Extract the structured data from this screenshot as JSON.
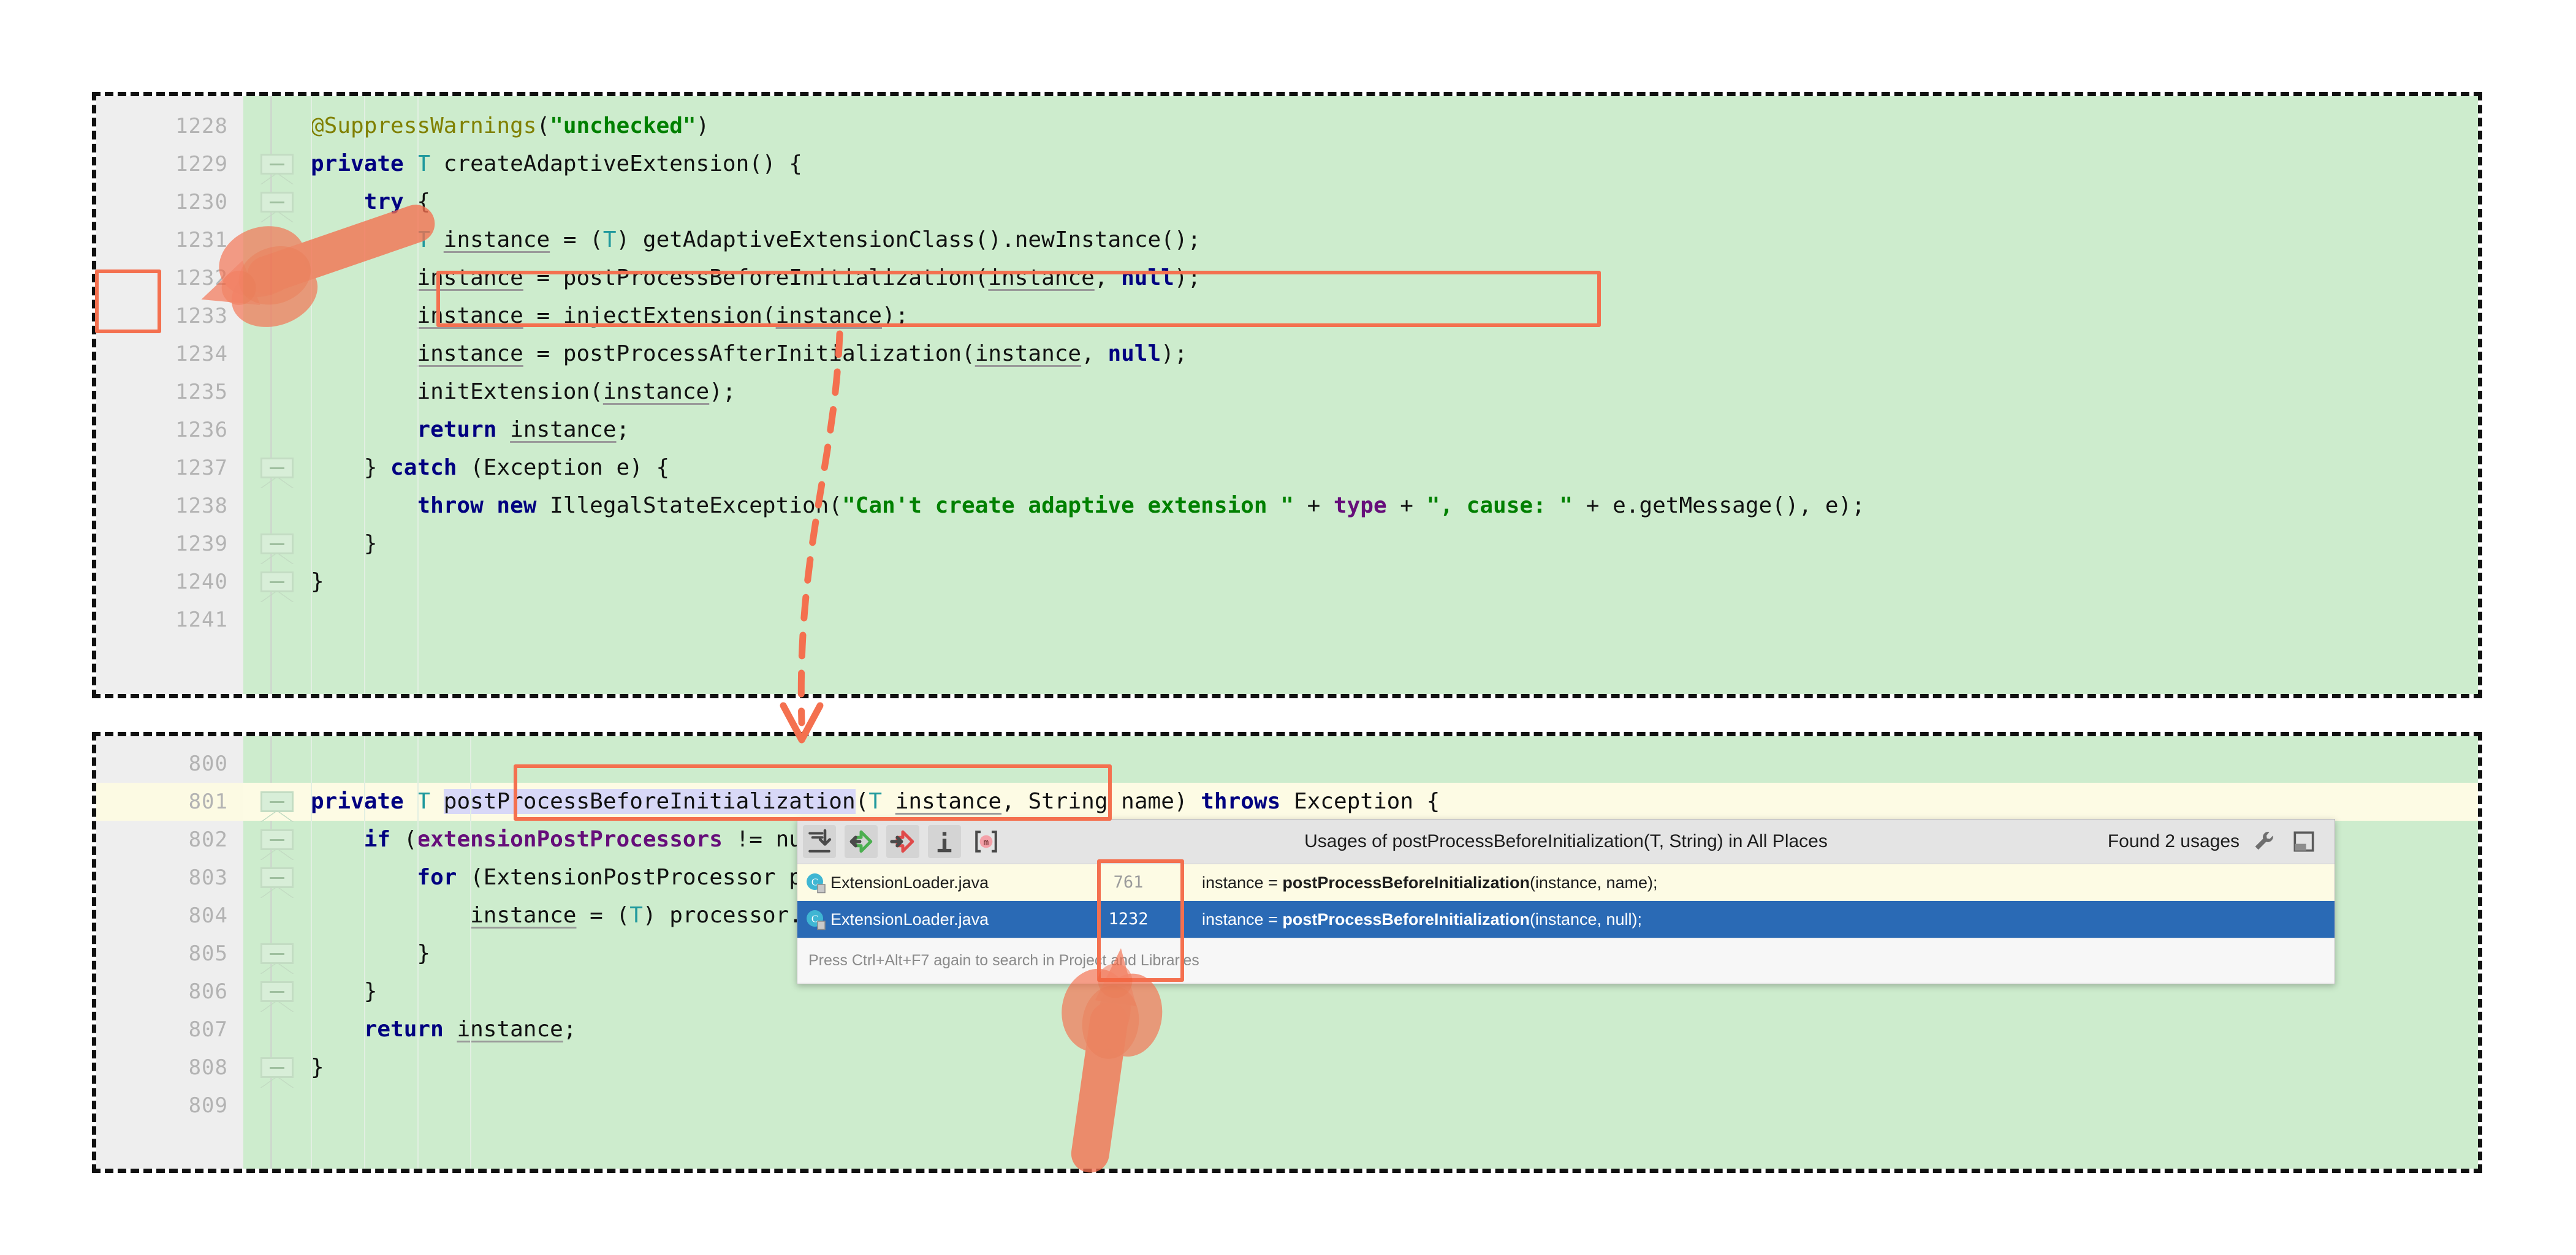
{
  "editor_top": {
    "name": "adaptive-extension-editor",
    "lines": [
      {
        "num": "1228",
        "indent": 2,
        "fold": false,
        "caret": false,
        "tokens": [
          {
            "t": "@SuppressWarnings",
            "c": "ann"
          },
          {
            "t": "(",
            "c": ""
          },
          {
            "t": "\"unchecked\"",
            "c": "str"
          },
          {
            "t": ")",
            "c": ""
          }
        ]
      },
      {
        "num": "1229",
        "indent": 2,
        "fold": true,
        "caret": false,
        "tokens": [
          {
            "t": "private ",
            "c": "kw"
          },
          {
            "t": "T",
            "c": "typ"
          },
          {
            "t": " createAdaptiveExtension() {",
            "c": ""
          }
        ]
      },
      {
        "num": "1230",
        "indent": 3,
        "fold": true,
        "caret": false,
        "tokens": [
          {
            "t": "    ",
            "c": ""
          },
          {
            "t": "try",
            "c": "kw"
          },
          {
            "t": " {",
            "c": ""
          }
        ]
      },
      {
        "num": "1231",
        "indent": 4,
        "fold": false,
        "caret": false,
        "tokens": [
          {
            "t": "        ",
            "c": ""
          },
          {
            "t": "T",
            "c": "typ"
          },
          {
            "t": " ",
            "c": ""
          },
          {
            "t": "instance",
            "c": "var"
          },
          {
            "t": " = (",
            "c": ""
          },
          {
            "t": "T",
            "c": "typ"
          },
          {
            "t": ") getAdaptiveExtensionClass().newInstance();",
            "c": ""
          }
        ]
      },
      {
        "num": "1232",
        "indent": 4,
        "fold": false,
        "caret": false,
        "tokens": [
          {
            "t": "        ",
            "c": ""
          },
          {
            "t": "instance",
            "c": "var"
          },
          {
            "t": " = postProcessBeforeInitialization(",
            "c": ""
          },
          {
            "t": "instance",
            "c": "var"
          },
          {
            "t": ", ",
            "c": ""
          },
          {
            "t": "null",
            "c": "kw"
          },
          {
            "t": ");",
            "c": ""
          }
        ]
      },
      {
        "num": "1233",
        "indent": 4,
        "fold": false,
        "caret": false,
        "tokens": [
          {
            "t": "        ",
            "c": ""
          },
          {
            "t": "instance",
            "c": "var"
          },
          {
            "t": " = injectExtension(",
            "c": ""
          },
          {
            "t": "instance",
            "c": "var"
          },
          {
            "t": ");",
            "c": ""
          }
        ]
      },
      {
        "num": "1234",
        "indent": 4,
        "fold": false,
        "caret": false,
        "tokens": [
          {
            "t": "        ",
            "c": ""
          },
          {
            "t": "instance",
            "c": "var"
          },
          {
            "t": " = postProcessAfterInitialization(",
            "c": ""
          },
          {
            "t": "instance",
            "c": "var"
          },
          {
            "t": ", ",
            "c": ""
          },
          {
            "t": "null",
            "c": "kw"
          },
          {
            "t": ");",
            "c": ""
          }
        ]
      },
      {
        "num": "1235",
        "indent": 4,
        "fold": false,
        "caret": false,
        "tokens": [
          {
            "t": "        initExtension(",
            "c": ""
          },
          {
            "t": "instance",
            "c": "var"
          },
          {
            "t": ");",
            "c": ""
          }
        ]
      },
      {
        "num": "1236",
        "indent": 4,
        "fold": false,
        "caret": false,
        "tokens": [
          {
            "t": "        ",
            "c": ""
          },
          {
            "t": "return",
            "c": "kw"
          },
          {
            "t": " ",
            "c": ""
          },
          {
            "t": "instance",
            "c": "var"
          },
          {
            "t": ";",
            "c": ""
          }
        ]
      },
      {
        "num": "1237",
        "indent": 3,
        "fold": true,
        "caret": false,
        "tokens": [
          {
            "t": "    } ",
            "c": ""
          },
          {
            "t": "catch",
            "c": "kw"
          },
          {
            "t": " (Exception e) {",
            "c": ""
          }
        ]
      },
      {
        "num": "1238",
        "indent": 4,
        "fold": false,
        "caret": false,
        "tokens": [
          {
            "t": "        ",
            "c": ""
          },
          {
            "t": "throw new",
            "c": "kw"
          },
          {
            "t": " IllegalStateException(",
            "c": ""
          },
          {
            "t": "\"Can't create adaptive extension \"",
            "c": "str"
          },
          {
            "t": " + ",
            "c": ""
          },
          {
            "t": "type",
            "c": "fld"
          },
          {
            "t": " + ",
            "c": ""
          },
          {
            "t": "\", cause: \"",
            "c": "str"
          },
          {
            "t": " + e.getMessage(), e);",
            "c": ""
          }
        ]
      },
      {
        "num": "1239",
        "indent": 3,
        "fold": true,
        "caret": false,
        "tokens": [
          {
            "t": "    }",
            "c": ""
          }
        ]
      },
      {
        "num": "1240",
        "indent": 2,
        "fold": true,
        "caret": false,
        "tokens": [
          {
            "t": "}",
            "c": ""
          }
        ]
      },
      {
        "num": "1241",
        "indent": 0,
        "fold": false,
        "caret": false,
        "tokens": []
      }
    ]
  },
  "editor_bottom": {
    "name": "post-process-editor",
    "lines": [
      {
        "num": "800",
        "indent": 0,
        "fold": false,
        "caret": false,
        "tokens": []
      },
      {
        "num": "801",
        "indent": 2,
        "fold": true,
        "caret": true,
        "tokens": [
          {
            "t": "private ",
            "c": "kw"
          },
          {
            "t": "T",
            "c": "typ"
          },
          {
            "t": " ",
            "c": ""
          },
          {
            "t": "postProcessBeforeInitialization",
            "c": "srch"
          },
          {
            "t": "(",
            "c": ""
          },
          {
            "t": "T",
            "c": "typ"
          },
          {
            "t": " ",
            "c": ""
          },
          {
            "t": "instance",
            "c": "var"
          },
          {
            "t": ", String name) ",
            "c": ""
          },
          {
            "t": "throws",
            "c": "kw"
          },
          {
            "t": " Exception {",
            "c": ""
          }
        ]
      },
      {
        "num": "802",
        "indent": 3,
        "fold": true,
        "caret": false,
        "tokens": [
          {
            "t": "    ",
            "c": ""
          },
          {
            "t": "if",
            "c": "kw"
          },
          {
            "t": " (",
            "c": ""
          },
          {
            "t": "extensionPostProcessors",
            "c": "fld"
          },
          {
            "t": " != null) {",
            "c": ""
          }
        ]
      },
      {
        "num": "803",
        "indent": 4,
        "fold": true,
        "caret": false,
        "tokens": [
          {
            "t": "        ",
            "c": ""
          },
          {
            "t": "for",
            "c": "kw"
          },
          {
            "t": " (ExtensionPostProcessor processor : extensionPostProcessors) {",
            "c": ""
          }
        ]
      },
      {
        "num": "804",
        "indent": 5,
        "fold": false,
        "caret": false,
        "tokens": [
          {
            "t": "            ",
            "c": ""
          },
          {
            "t": "instance",
            "c": "var"
          },
          {
            "t": " = (",
            "c": ""
          },
          {
            "t": "T",
            "c": "typ"
          },
          {
            "t": ") processor.postProcessBeforeInitialization(instance, name);",
            "c": ""
          }
        ]
      },
      {
        "num": "805",
        "indent": 4,
        "fold": true,
        "caret": false,
        "tokens": [
          {
            "t": "        }",
            "c": ""
          }
        ]
      },
      {
        "num": "806",
        "indent": 3,
        "fold": true,
        "caret": false,
        "tokens": [
          {
            "t": "    }",
            "c": ""
          }
        ]
      },
      {
        "num": "807",
        "indent": 3,
        "fold": false,
        "caret": false,
        "tokens": [
          {
            "t": "    ",
            "c": ""
          },
          {
            "t": "return",
            "c": "kw"
          },
          {
            "t": " ",
            "c": ""
          },
          {
            "t": "instance",
            "c": "var"
          },
          {
            "t": ";",
            "c": ""
          }
        ]
      },
      {
        "num": "808",
        "indent": 2,
        "fold": true,
        "caret": false,
        "tokens": [
          {
            "t": "}",
            "c": ""
          }
        ]
      },
      {
        "num": "809",
        "indent": 0,
        "fold": false,
        "caret": false,
        "tokens": []
      }
    ]
  },
  "usages_popup": {
    "title": "Usages of postProcessBeforeInitialization(T, String) in All Places",
    "found_label": "Found 2 usages",
    "hint": "Press Ctrl+Alt+F7 again to search in Project and Libraries",
    "toolbar_icons": [
      "expand-all-icon",
      "previous-occurrence-icon",
      "next-occurrence-icon",
      "show-info-icon",
      "method-marker-icon"
    ],
    "right_icons": [
      "settings-wrench-icon",
      "open-in-panel-icon"
    ],
    "columns": [
      "file",
      "line",
      "snippet"
    ],
    "results": [
      {
        "file": "ExtensionLoader.java",
        "line": "761",
        "prefix": "instance = ",
        "method": "postProcessBeforeInitialization",
        "suffix": "(instance, name);",
        "selected": false,
        "icon": "java-class-icon"
      },
      {
        "file": "ExtensionLoader.java",
        "line": "1232",
        "prefix": "instance = ",
        "method": "postProcessBeforeInitialization",
        "suffix": "(instance, null);",
        "selected": true,
        "icon": "java-class-icon"
      }
    ]
  },
  "annotations": {
    "accent_color": "#f4704f",
    "boxes": [
      {
        "name": "call-site-line-number-box",
        "label": "1232"
      },
      {
        "name": "call-site-code-box",
        "label": "instance = postProcessBeforeInitialization(instance, null);"
      },
      {
        "name": "method-declaration-box",
        "label": "postProcessBeforeInitialization"
      },
      {
        "name": "usage-line-number-box",
        "label": "1232"
      }
    ],
    "pointers": [
      {
        "name": "hand-pointer-call-site"
      },
      {
        "name": "hand-pointer-usage-result"
      }
    ],
    "flow_arrow": {
      "name": "navigation-flow-arrow",
      "style": "dashed-curved"
    }
  },
  "colors": {
    "editor_background": "#cdeccd",
    "gutter_background": "#eeeeee",
    "caret_line": "#fdfbe4",
    "selection_blue": "#2a6ab5",
    "search_highlight": "#d8d8f7",
    "accent": "#f4704f"
  }
}
